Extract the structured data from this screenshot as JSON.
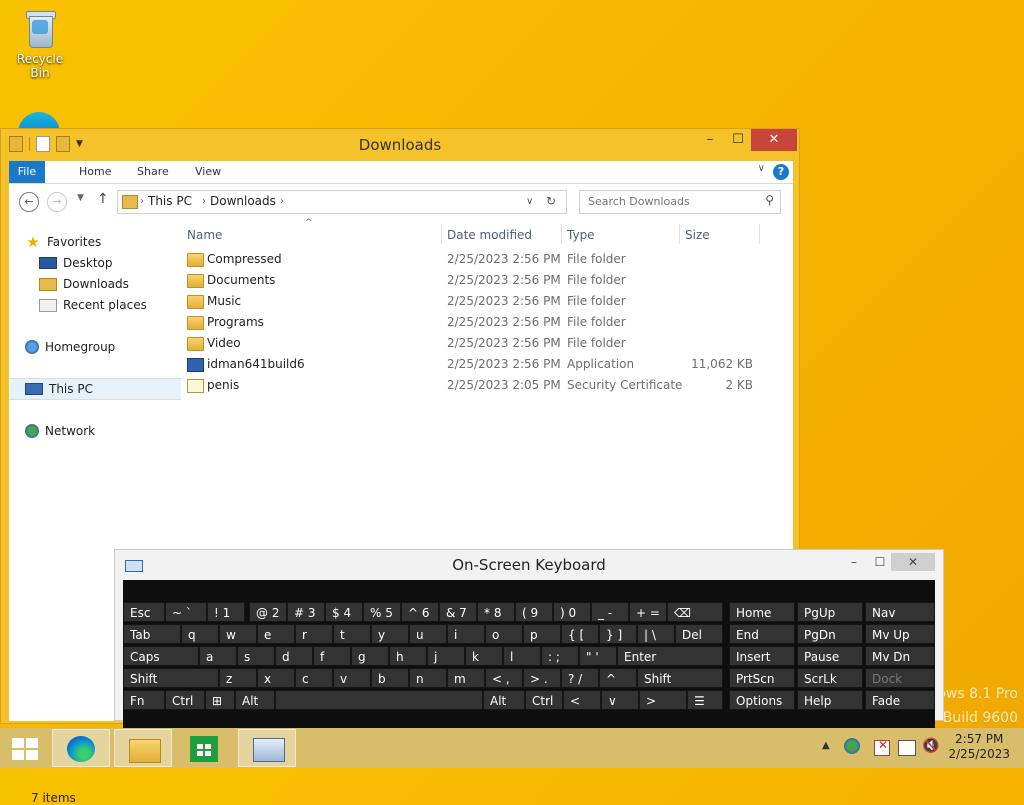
{
  "desktop": {
    "recycle_bin": "Recycle Bin",
    "watermark_line1": "ows 8.1 Pro",
    "watermark_line2": "Build 9600"
  },
  "explorer": {
    "title": "Downloads",
    "ribbon_tabs": [
      "File",
      "Home",
      "Share",
      "View"
    ],
    "breadcrumb": [
      "This PC",
      "Downloads"
    ],
    "search_placeholder": "Search Downloads",
    "nav": {
      "favorites": "Favorites",
      "desktop": "Desktop",
      "downloads": "Downloads",
      "recent": "Recent places",
      "homegroup": "Homegroup",
      "this_pc": "This PC",
      "network": "Network"
    },
    "columns": {
      "name": "Name",
      "date": "Date modified",
      "type": "Type",
      "size": "Size"
    },
    "files": [
      {
        "name": "Compressed",
        "date": "2/25/2023 2:56 PM",
        "type": "File folder",
        "size": "",
        "icon": "folder"
      },
      {
        "name": "Documents",
        "date": "2/25/2023 2:56 PM",
        "type": "File folder",
        "size": "",
        "icon": "folder"
      },
      {
        "name": "Music",
        "date": "2/25/2023 2:56 PM",
        "type": "File folder",
        "size": "",
        "icon": "folder"
      },
      {
        "name": "Programs",
        "date": "2/25/2023 2:56 PM",
        "type": "File folder",
        "size": "",
        "icon": "folder"
      },
      {
        "name": "Video",
        "date": "2/25/2023 2:56 PM",
        "type": "File folder",
        "size": "",
        "icon": "folder"
      },
      {
        "name": "idman641build6",
        "date": "2/25/2023 2:56 PM",
        "type": "Application",
        "size": "11,062 KB",
        "icon": "app"
      },
      {
        "name": "penis",
        "date": "2/25/2023 2:05 PM",
        "type": "Security Certificate",
        "size": "2 KB",
        "icon": "cert"
      }
    ],
    "status": "7 items"
  },
  "osk": {
    "title": "On-Screen Keyboard",
    "rows": [
      [
        "Esc",
        "~ `",
        "! 1",
        "@ 2",
        "# 3",
        "$ 4",
        "% 5",
        "^ 6",
        "& 7",
        "* 8",
        "( 9",
        ") 0",
        "_ -",
        "+ =",
        "⌫"
      ],
      [
        "Tab",
        "q",
        "w",
        "e",
        "r",
        "t",
        "y",
        "u",
        "i",
        "o",
        "p",
        "{ [",
        "} ]",
        "| \\",
        "Del"
      ],
      [
        "Caps",
        "a",
        "s",
        "d",
        "f",
        "g",
        "h",
        "j",
        "k",
        "l",
        ": ;",
        "\" '",
        "Enter"
      ],
      [
        "Shift",
        "z",
        "x",
        "c",
        "v",
        "b",
        "n",
        "m",
        "< ,",
        "> .",
        "? /",
        "^",
        "Shift"
      ],
      [
        "Fn",
        "Ctrl",
        "⊞",
        "Alt",
        "",
        "Alt",
        "Ctrl",
        "<",
        "∨",
        ">",
        "☰"
      ]
    ],
    "side": [
      [
        "Home",
        "PgUp",
        "Nav"
      ],
      [
        "End",
        "PgDn",
        "Mv Up"
      ],
      [
        "Insert",
        "Pause",
        "Mv Dn"
      ],
      [
        "PrtScn",
        "ScrLk",
        "Dock"
      ],
      [
        "Options",
        "Help",
        "Fade"
      ]
    ]
  },
  "taskbar": {
    "time": "2:57 PM",
    "date": "2/25/2023"
  }
}
